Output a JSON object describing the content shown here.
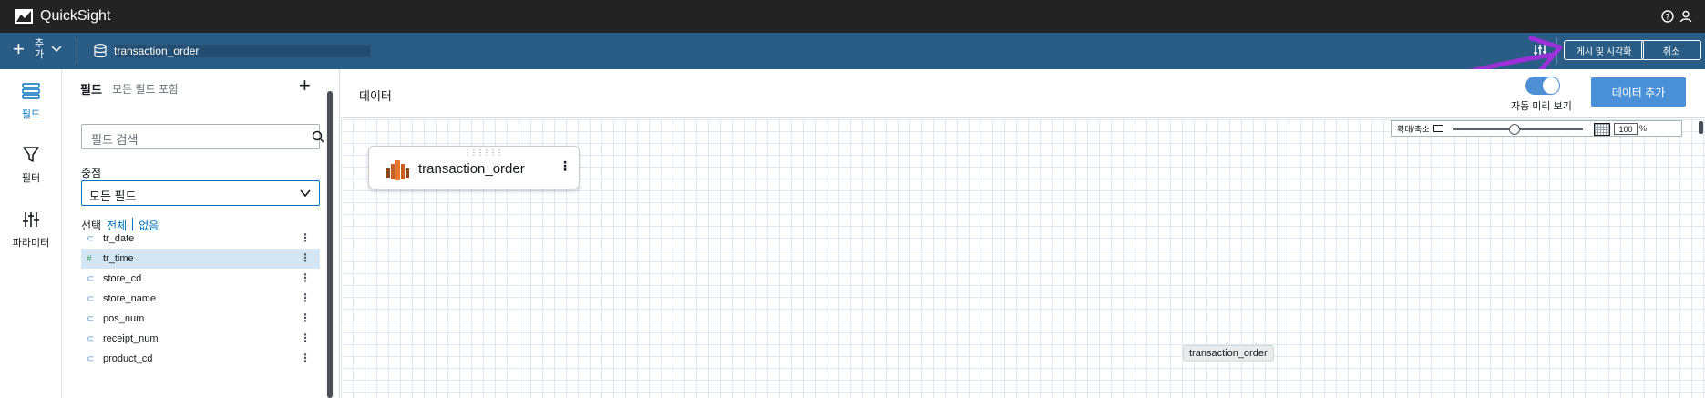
{
  "topbar": {
    "title": "QuickSight"
  },
  "toolbar": {
    "add_label": "추가",
    "dataset_name": "transaction_order",
    "publish_label": "게시 및 시각화",
    "cancel_label": "취소"
  },
  "leftnav": {
    "items": [
      {
        "label": "필드",
        "icon": "fields-icon"
      },
      {
        "label": "필터",
        "icon": "filter-icon"
      },
      {
        "label": "파라미터",
        "icon": "parameters-icon"
      }
    ]
  },
  "panel": {
    "title": "필드",
    "subtitle": "모든 필드 포함",
    "search_placeholder": "필드 검색",
    "focus_label": "중점",
    "focus_value": "모든 필드",
    "select_label": "선택",
    "select_all": "전체",
    "select_none": "없음",
    "fields": [
      {
        "name": "tr_date",
        "type": "string"
      },
      {
        "name": "tr_time",
        "type": "number"
      },
      {
        "name": "store_cd",
        "type": "string"
      },
      {
        "name": "store_name",
        "type": "string"
      },
      {
        "name": "pos_num",
        "type": "string"
      },
      {
        "name": "receipt_num",
        "type": "string"
      },
      {
        "name": "product_cd",
        "type": "string"
      }
    ]
  },
  "main": {
    "title": "데이터",
    "auto_preview_label": "자동 미리 보기",
    "add_data_label": "데이터 추가",
    "zoom_label": "확대/축소",
    "zoom_value": "100",
    "zoom_unit": "%",
    "zoom_fraction": 0.47,
    "node_label": "transaction_order",
    "tooltip_label": "transaction_order"
  },
  "colors": {
    "topbar_bg": "#232323",
    "toolbar_bg": "#2a5d86",
    "accent": "#0073bb",
    "primary_button": "#4a90d9",
    "annotation_arrow": "#9b30d9"
  }
}
